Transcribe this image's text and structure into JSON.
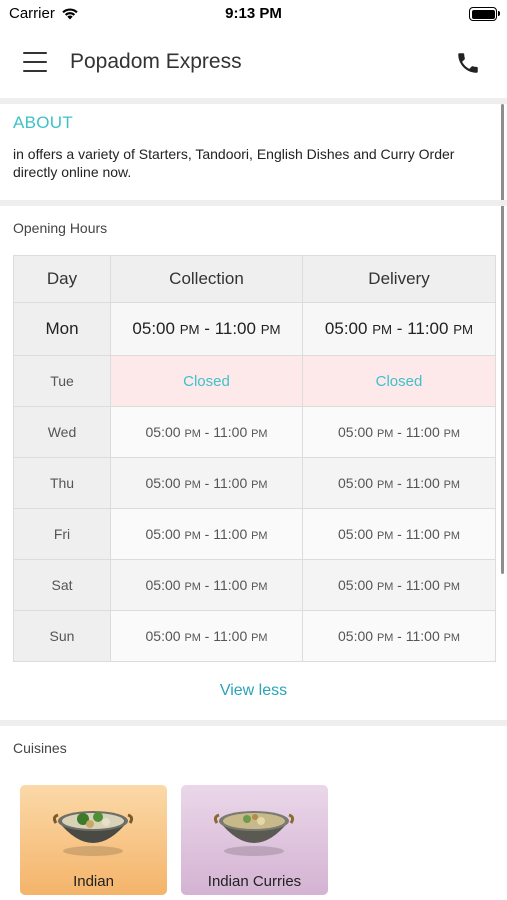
{
  "status_bar": {
    "carrier": "Carrier",
    "time": "9:13 PM"
  },
  "header": {
    "title": "Popadom Express"
  },
  "about": {
    "heading": "ABOUT",
    "text": "in  offers a variety of Starters, Tandoori, English Dishes and Curry Order directly online now."
  },
  "opening_hours": {
    "heading": "Opening Hours",
    "columns": [
      "Day",
      "Collection",
      "Delivery"
    ],
    "rows": [
      {
        "day": "Mon",
        "collection": [
          "05:00",
          "PM",
          "11:00",
          "PM"
        ],
        "delivery": [
          "05:00",
          "PM",
          "11:00",
          "PM"
        ]
      },
      {
        "day": "Tue",
        "collection_status": "Closed",
        "delivery_status": "Closed"
      },
      {
        "day": "Wed",
        "collection": [
          "05:00",
          "PM",
          "11:00",
          "PM"
        ],
        "delivery": [
          "05:00",
          "PM",
          "11:00",
          "PM"
        ]
      },
      {
        "day": "Thu",
        "collection": [
          "05:00",
          "PM",
          "11:00",
          "PM"
        ],
        "delivery": [
          "05:00",
          "PM",
          "11:00",
          "PM"
        ]
      },
      {
        "day": "Fri",
        "collection": [
          "05:00",
          "PM",
          "11:00",
          "PM"
        ],
        "delivery": [
          "05:00",
          "PM",
          "11:00",
          "PM"
        ]
      },
      {
        "day": "Sat",
        "collection": [
          "05:00",
          "PM",
          "11:00",
          "PM"
        ],
        "delivery": [
          "05:00",
          "PM",
          "11:00",
          "PM"
        ]
      },
      {
        "day": "Sun",
        "collection": [
          "05:00",
          "PM",
          "11:00",
          "PM"
        ],
        "delivery": [
          "05:00",
          "PM",
          "11:00",
          "PM"
        ]
      }
    ],
    "separator": " - ",
    "toggle_label": "View less"
  },
  "cuisines": {
    "heading": "Cuisines",
    "items": [
      {
        "label": "Indian"
      },
      {
        "label": "Indian Curries"
      }
    ]
  },
  "colors": {
    "accent": "#3fc1c9",
    "link": "#2aa3b8",
    "closed_bg": "#fde8ea"
  },
  "icons": [
    "menu-icon",
    "phone-icon",
    "wifi-icon",
    "battery-icon"
  ]
}
